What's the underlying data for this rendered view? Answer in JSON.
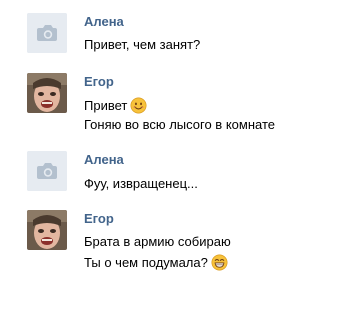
{
  "messages": [
    {
      "author": "Алена",
      "avatar": "camera-placeholder-icon",
      "lines": [
        "Привет, чем занят?"
      ]
    },
    {
      "author": "Егор",
      "avatar": "user-photo",
      "lines": [
        "Привет",
        "Гоняю во всю лысого в комнате"
      ],
      "emoji": "smile-emoji"
    },
    {
      "author": "Алена",
      "avatar": "camera-placeholder-icon",
      "lines": [
        "Фуу, извращенец..."
      ]
    },
    {
      "author": "Егор",
      "avatar": "user-photo",
      "lines": [
        "Брата в армию собираю",
        "Ты о чем подумала?"
      ],
      "emoji": "grin-emoji"
    }
  ],
  "colors": {
    "author_name": "#42648b",
    "placeholder_bg": "#e6ebf1",
    "placeholder_icon": "#b3c0ce",
    "emoji": "#f7c23b"
  }
}
